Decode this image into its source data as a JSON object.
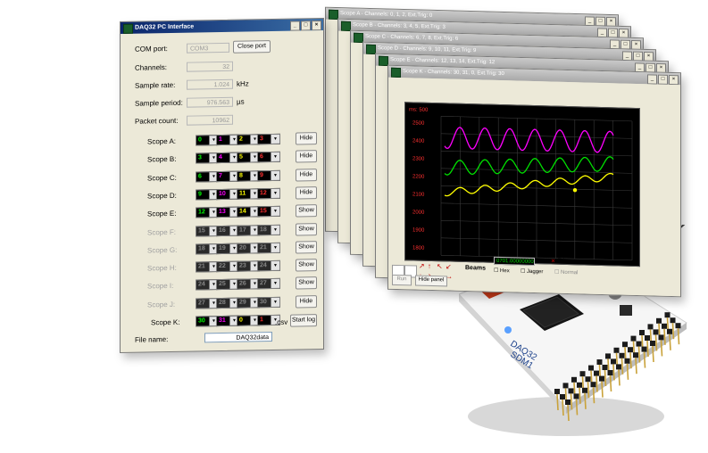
{
  "main_window": {
    "title": "DAQ32 PC Interface",
    "com_port_label": "COM port:",
    "com_port_value": "COM3",
    "close_port_label": "Close port",
    "channels_label": "Channels:",
    "channels_value": "32",
    "sample_rate_label": "Sample rate:",
    "sample_rate_value": "1.024",
    "sample_rate_unit": "kHz",
    "sample_period_label": "Sample period:",
    "sample_period_value": "976.563",
    "sample_period_unit": "µs",
    "packet_count_label": "Packet count:",
    "packet_count_value": "10962",
    "scopes": [
      {
        "label": "Scope A:",
        "channels": [
          "0",
          "1",
          "2",
          "3"
        ],
        "colors": [
          "#00ff00",
          "#ff00ff",
          "#ffff00",
          "#ff3030"
        ],
        "button": "Hide",
        "enabled": true
      },
      {
        "label": "Scope B:",
        "channels": [
          "3",
          "4",
          "5",
          "6"
        ],
        "colors": [
          "#00ff00",
          "#ff00ff",
          "#ffff00",
          "#ff3030"
        ],
        "button": "Hide",
        "enabled": true
      },
      {
        "label": "Scope C:",
        "channels": [
          "6",
          "7",
          "8",
          "9"
        ],
        "colors": [
          "#00ff00",
          "#ff00ff",
          "#ffff00",
          "#ff3030"
        ],
        "button": "Hide",
        "enabled": true
      },
      {
        "label": "Scope D:",
        "channels": [
          "9",
          "10",
          "11",
          "12"
        ],
        "colors": [
          "#00ff00",
          "#ff00ff",
          "#ffff00",
          "#ff3030"
        ],
        "button": "Hide",
        "enabled": true
      },
      {
        "label": "Scope E:",
        "channels": [
          "12",
          "13",
          "14",
          "15"
        ],
        "colors": [
          "#00ff00",
          "#ff00ff",
          "#ffff00",
          "#ff3030"
        ],
        "button": "Show",
        "enabled": true
      },
      {
        "label": "Scope F:",
        "channels": [
          "15",
          "16",
          "17",
          "18"
        ],
        "colors": [
          "#00ff00",
          "#ff00ff",
          "#ffff00",
          "#ff3030"
        ],
        "button": "Show",
        "enabled": false
      },
      {
        "label": "Scope G:",
        "channels": [
          "18",
          "19",
          "20",
          "21"
        ],
        "colors": [
          "#00ff00",
          "#ff00ff",
          "#ffff00",
          "#ff3030"
        ],
        "button": "Show",
        "enabled": false
      },
      {
        "label": "Scope H:",
        "channels": [
          "21",
          "22",
          "23",
          "24"
        ],
        "colors": [
          "#00ff00",
          "#ff00ff",
          "#ffff00",
          "#ff3030"
        ],
        "button": "Show",
        "enabled": false
      },
      {
        "label": "Scope I:",
        "channels": [
          "24",
          "25",
          "26",
          "27"
        ],
        "colors": [
          "#00ff00",
          "#ff00ff",
          "#ffff00",
          "#ff3030"
        ],
        "button": "Show",
        "enabled": false
      },
      {
        "label": "Scope J:",
        "channels": [
          "27",
          "28",
          "29",
          "30"
        ],
        "colors": [
          "#00ff00",
          "#ff00ff",
          "#ffff00",
          "#ff3030"
        ],
        "button": "Hide",
        "enabled": false
      },
      {
        "label": "Scope K:",
        "channels": [
          "30",
          "31",
          "0",
          "1"
        ],
        "colors": [
          "#00ff00",
          "#ff00ff",
          "#ffff00",
          "#ff3030"
        ],
        "button": "",
        "enabled": true
      }
    ],
    "file_name_label": "File name:",
    "file_name_value": "DAQ32data",
    "file_ext": ".csv",
    "start_log_label": "Start log"
  },
  "scope_windows": [
    {
      "title": "Scope A - Channels: 0, 1, 2, Ext.Trig: 0"
    },
    {
      "title": "Scope B - Channels: 3, 4, 5, Ext.Trig: 3"
    },
    {
      "title": "Scope C - Channels: 6, 7, 8, Ext.Trig: 6"
    },
    {
      "title": "Scope D - Channels: 9, 10, 11, Ext.Trig: 9"
    },
    {
      "title": "Scope E - Channels: 12, 13, 14, Ext.Trig: 12"
    },
    {
      "title": "Scope K - Channels: 30, 31, 0, Ext.Trig: 30"
    }
  ],
  "front_scope": {
    "y_label": "ms: 500",
    "y_ticks": [
      "2500",
      "2400",
      "2300",
      "2200",
      "2100",
      "2000",
      "1900",
      "1800"
    ],
    "hex_label": "Hex",
    "jagger_label": "Jagger",
    "beams_label": "Beams",
    "trigger_label": "Trigger",
    "normal_label": "Normal",
    "value_readout": "0701.00000000",
    "hide_panel_label": "Hide panel",
    "run_label": "Run",
    "channel_colors": [
      "#ff00ff",
      "#00e000",
      "#ffff00"
    ]
  },
  "device": {
    "label_line1": "DAQ32",
    "label_line2": "SDM1"
  }
}
